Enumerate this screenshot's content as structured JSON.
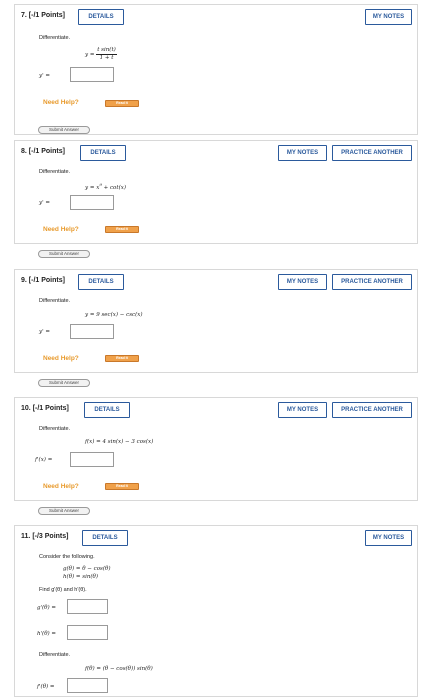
{
  "ui": {
    "details": "DETAILS",
    "my_notes": "MY NOTES",
    "practice_another": "PRACTICE ANOTHER",
    "need_help": "Need Help?",
    "read_it": "Read It",
    "submit_answer": "Submit Answer",
    "differentiate": "Differentiate."
  },
  "questions": [
    {
      "number": "7.",
      "points": "[-/1 Points]",
      "eq_lhs": "y =",
      "eq_num": "t sin(t)",
      "eq_den": "1 + t",
      "answer_label": "y' ="
    },
    {
      "number": "8.",
      "points": "[-/1 Points]",
      "eq": "y = x",
      "eq_exp": "9",
      "eq_rest": " + cot(x)",
      "answer_label": "y' ="
    },
    {
      "number": "9.",
      "points": "[-/1 Points]",
      "eq": "y = 9 sec(x) − csc(x)",
      "answer_label": "y' ="
    },
    {
      "number": "10.",
      "points": "[-/1 Points]",
      "eq": "f(x) = 4 sin(x) − 3 cos(x)",
      "answer_label": "f'(x) ="
    },
    {
      "number": "11.",
      "points": "[-/3 Points]",
      "consider": "Consider the following.",
      "eq_g": "g(θ) = θ − cos(θ)",
      "eq_h": "h(θ) = sin(θ)",
      "find": "Find g'(θ) and h'(θ).",
      "g_label": "g'(θ) =",
      "h_label": "h'(θ) =",
      "eq_f": "f(θ) = (θ − cos(θ)) sin(θ)",
      "f_label": "f'(θ) ="
    }
  ]
}
